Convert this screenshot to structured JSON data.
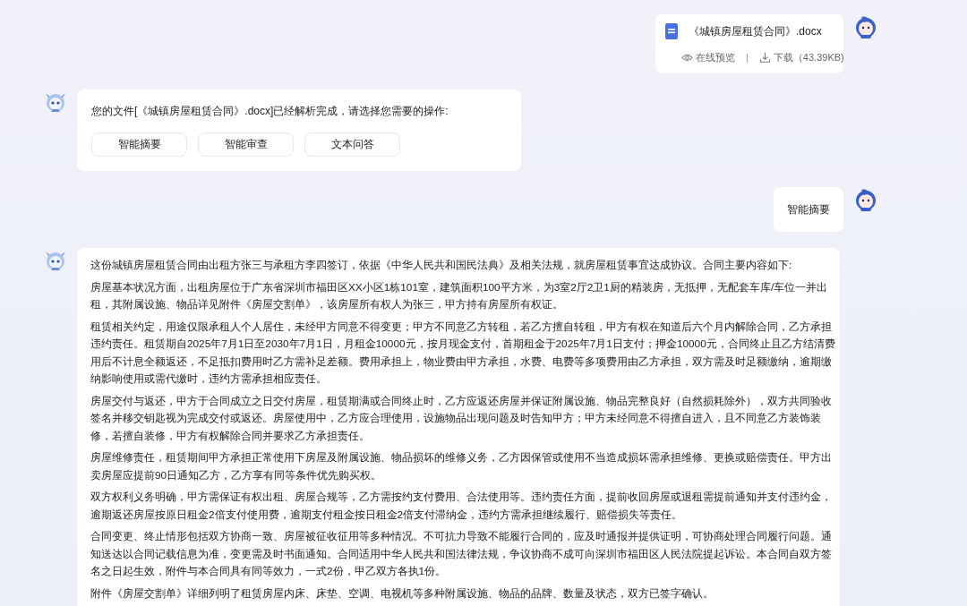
{
  "messages": [
    {
      "kind": "user-file",
      "file_name": "《城镇房屋租赁合同》.docx",
      "preview_label": "在线预览",
      "separator": "|",
      "download_label": "下载（43.39KB)"
    },
    {
      "kind": "bot-actions",
      "text": "您的文件[《城镇房屋租赁合同》.docx]已经解析完成，请选择您需要的操作:",
      "actions": [
        "智能摘要",
        "智能审查",
        "文本问答"
      ]
    },
    {
      "kind": "user-text",
      "text": "智能摘要"
    },
    {
      "kind": "bot-paragraphs",
      "paragraphs": [
        "这份城镇房屋租赁合同由出租方张三与承租方李四签订，依据《中华人民共和国民法典》及相关法规，就房屋租赁事宜达成协议。合同主要内容如下:",
        "房屋基本状况方面，出租房屋位于广东省深圳市福田区XX小区1栋101室，建筑面积100平方米，为3室2厅2卫1厨的精装房，无抵押，无配套车库/车位一并出租，其附属设施、物品详见附件《房屋交割单》，该房屋所有权人为张三，甲方持有房屋所有权证。",
        "租赁相关约定，用途仅限承租人个人居住，未经甲方同意不得变更；甲方不同意乙方转租，若乙方擅自转租，甲方有权在知道后六个月内解除合同，乙方承担违约责任。租赁期自2025年7月1日至2030年7月1日，月租金10000元，按月现金支付，首期租金于2025年7月1日支付；押金10000元，合同终止且乙方结清费用后不计息全额返还，不足抵扣费用时乙方需补足差额。费用承担上，物业费由甲方承担，水费、电费等多项费用由乙方承担，双方需及时足额缴纳，逾期缴纳影响使用或需代缴时，违约方需承担相应责任。",
        "房屋交付与返还，甲方于合同成立之日交付房屋，租赁期满或合同终止时，乙方应返还房屋并保证附属设施、物品完整良好（自然损耗除外），双方共同验收签名并移交钥匙视为完成交付或返还。房屋使用中，乙方应合理使用，设施物品出现问题及时告知甲方；甲方未经同意不得擅自进入，且不同意乙方装饰装修，若擅自装修，甲方有权解除合同并要求乙方承担责任。",
        "房屋维修责任，租赁期间甲方承担正常使用下房屋及附属设施、物品损坏的维修义务，乙方因保管或使用不当造成损坏需承担维修、更换或赔偿责任。甲方出卖房屋应提前90日通知乙方，乙方享有同等条件优先购买权。",
        "双方权利义务明确，甲方需保证有权出租、房屋合规等，乙方需按约支付费用、合法使用等。违约责任方面，提前收回房屋或退租需提前通知并支付违约金，逾期返还房屋按原日租金2倍支付使用费，逾期支付租金按日租金2倍支付滞纳金，违约方需承担继续履行、赔偿损失等责任。",
        "合同变更、终止情形包括双方协商一致、房屋被征收征用等多种情况。不可抗力导致不能履行合同的，应及时通报并提供证明，可协商处理合同履行问题。通知送达以合同记载信息为准，变更需及时书面通知。合同适用中华人民共和国法律法规，争议协商不成可向深圳市福田区人民法院提起诉讼。本合同自双方签名之日起生效，附件与本合同具有同等效力，一式2份，甲乙双方各执1份。",
        "附件《房屋交割单》详细列明了租赁房屋内床、床垫、空调、电视机等多种附属设施、物品的品牌、数量及状态，双方已签字确认。"
      ]
    }
  ]
}
